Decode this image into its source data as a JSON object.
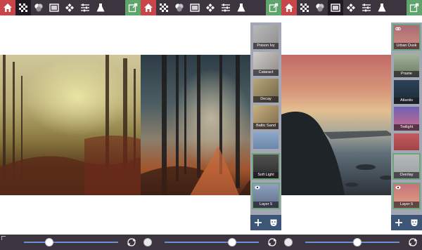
{
  "toolbar": {
    "icons": [
      "home-icon",
      "checkerboard-icon",
      "blend-circles-icon",
      "gradient-frame-icon",
      "diamond-tiles-icon",
      "sliders-icon",
      "flask-icon",
      "export-icon"
    ]
  },
  "panes": [
    {
      "active_tool": "checkerboard-icon",
      "slider_value": 0.27,
      "layers": []
    },
    {
      "active_tool": "none",
      "slider_value": 0.72,
      "layers": [
        {
          "label": "Poison Ivy"
        },
        {
          "label": "Cataract"
        },
        {
          "label": "Decay"
        },
        {
          "label": "Baltic Sand"
        },
        {
          "label": ""
        },
        {
          "label": "Soft Light"
        },
        {
          "label": "Layer 5"
        }
      ]
    },
    {
      "active_tool": "gradient-frame-icon",
      "slider_value": 0.55,
      "layers": [
        {
          "label": "Urban Dusk"
        },
        {
          "label": "Prairie"
        },
        {
          "label": "Atlantis"
        },
        {
          "label": "Twilight"
        },
        {
          "label": ""
        },
        {
          "label": "Overlay"
        },
        {
          "label": "Layer 5"
        }
      ]
    }
  ],
  "colors": {
    "toolbar_bg": "#3c3540",
    "home_bg": "#c8464a",
    "export_bg": "#5fa56b",
    "panel_bg": "#a3a6b3",
    "panel_tools_bg": "#3d5577",
    "slider_track": "#6b8fd0"
  }
}
